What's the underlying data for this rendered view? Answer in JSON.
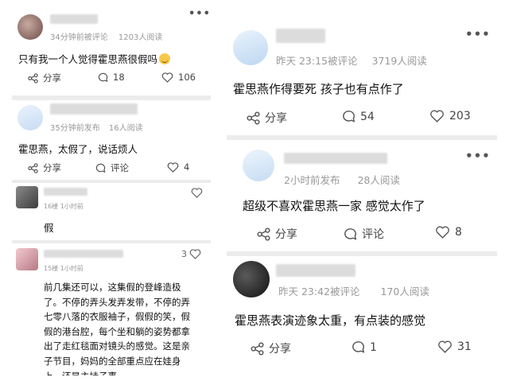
{
  "left_panel": {
    "posts": [
      {
        "meta_time": "34分钟前被评论",
        "meta_reads": "1203人阅读",
        "content": "只有我一个人觉得霍思燕很假吗",
        "emoji_icon": "grinning-face-icon",
        "share_label": "分享",
        "comment_count": "18",
        "like_count": "106"
      },
      {
        "meta_time": "35分钟前发布",
        "meta_reads": "16人阅读",
        "content": "霍思燕，太假了，说话烦人",
        "share_label": "分享",
        "comment_label": "评论",
        "like_count": "4"
      },
      {
        "meta_short": "16楼 1小时前",
        "content": "假"
      },
      {
        "meta_short": "15楼 1小时前",
        "like_count": "3",
        "content_lines": [
          "前几集还可以，这集假的登峰造极",
          "了。不停的弄头发弄发带，不停的弄",
          "七零八落的衣服袖子，假假的笑，假",
          "假的港台腔，每个坐和躺的姿势都拿",
          "出了走红毯面对镜头的感觉。这是亲",
          "子节目，妈妈的全部重点应在娃身",
          "上，还是主持子事"
        ]
      }
    ]
  },
  "right_panel": {
    "posts": [
      {
        "meta_time": "昨天 23:15被评论",
        "meta_reads": "3719人阅读",
        "content": "霍思燕作得要死  孩子也有点作了",
        "share_label": "分享",
        "comment_count": "54",
        "like_count": "203"
      },
      {
        "meta_time": "2小时前发布",
        "meta_reads": "28人阅读",
        "content": "超级不喜欢霍思燕一家 感觉太作了",
        "share_label": "分享",
        "comment_label": "评论",
        "like_count": "8"
      },
      {
        "meta_time": "昨天 23:42被评论",
        "meta_reads": "170人阅读",
        "content": "霍思燕表演迹象太重，有点装的感觉",
        "share_label": "分享",
        "comment_count": "1",
        "like_count": "31"
      }
    ]
  },
  "more_icon": "•••"
}
